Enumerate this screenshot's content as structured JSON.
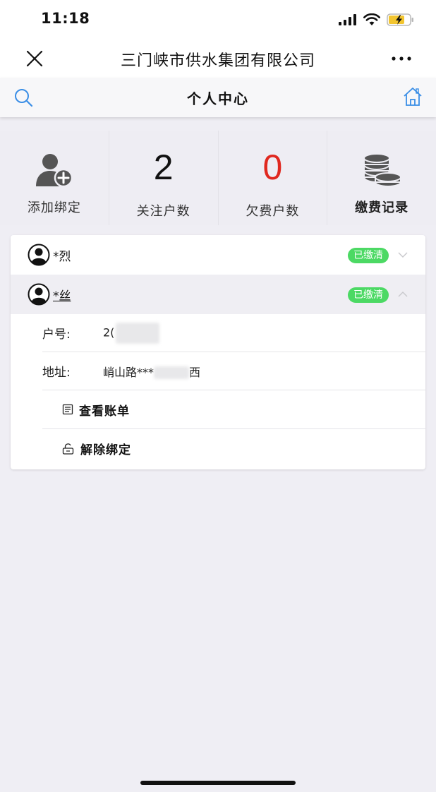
{
  "status_bar": {
    "time": "11:18"
  },
  "nav": {
    "title": "三门峡市供水集团有限公司"
  },
  "sub_header": {
    "title": "个人中心"
  },
  "stats": {
    "add_binding_label": "添加绑定",
    "followed_count": "2",
    "followed_label": "关注户数",
    "arrears_count": "0",
    "arrears_label": "欠费户数",
    "payment_records_label": "缴费记录"
  },
  "accounts": [
    {
      "name": "*烈",
      "status": "已缴清",
      "expanded": false
    },
    {
      "name": "*丝",
      "status": "已缴清",
      "expanded": true
    }
  ],
  "details": {
    "account_no_label": "户号:",
    "account_no_value": "2(",
    "address_label": "地址:",
    "address_value_prefix": "峭山路***",
    "address_value_suffix": "西"
  },
  "actions": {
    "view_bill": "查看账单",
    "unbind": "解除绑定"
  },
  "colors": {
    "badge_green": "#4cd964",
    "arrears_red": "#e0281f",
    "home_icon_blue": "#3a8ee6",
    "search_icon_blue": "#3a8ee6"
  }
}
